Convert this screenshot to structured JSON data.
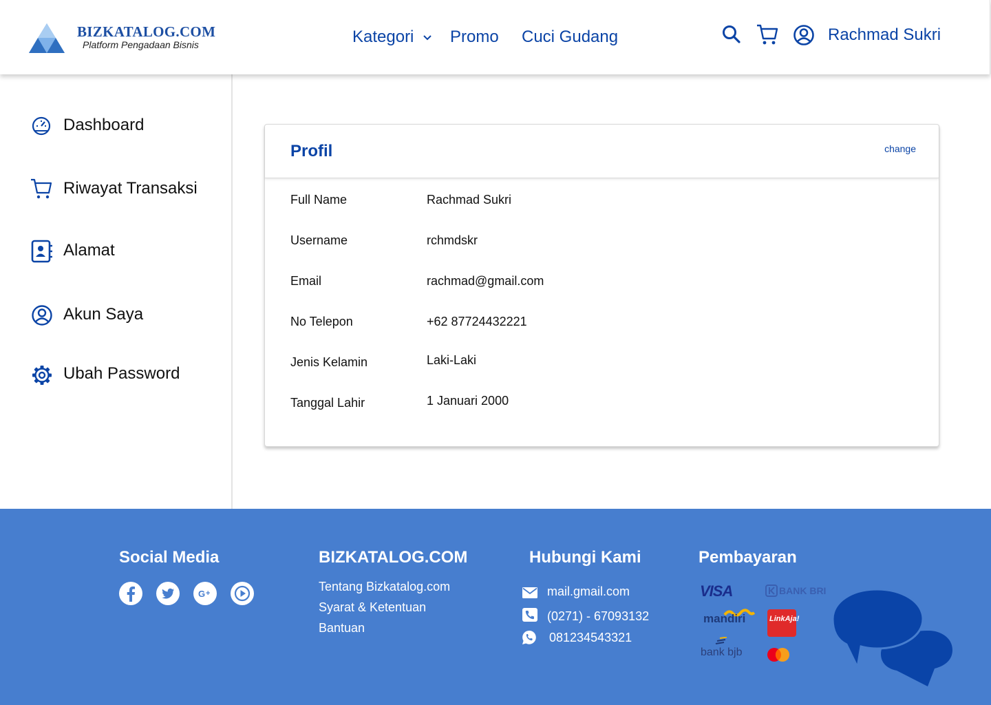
{
  "brand": {
    "name": "BIZKATALOG.COM",
    "tagline": "Platform Pengadaan Bisnis"
  },
  "header": {
    "nav": [
      {
        "label": "Kategori",
        "has_dropdown": true
      },
      {
        "label": "Promo"
      },
      {
        "label": "Cuci Gudang"
      }
    ],
    "icons": [
      "search-icon",
      "cart-icon",
      "user-circle-icon"
    ],
    "user_name": "Rachmad Sukri"
  },
  "sidebar": {
    "items": [
      {
        "label": "Dashboard",
        "icon": "speedometer-icon"
      },
      {
        "label": "Riwayat Transaksi",
        "icon": "cart-icon"
      },
      {
        "label": "Alamat",
        "icon": "address-book-icon"
      },
      {
        "label": "Akun Saya",
        "icon": "user-circle-icon"
      },
      {
        "label": "Ubah Password",
        "icon": "gear-icon"
      }
    ]
  },
  "profile": {
    "title": "Profil",
    "change_label": "change",
    "rows": [
      {
        "label": "Full Name",
        "value": "Rachmad Sukri"
      },
      {
        "label": "Username",
        "value": "rchmdskr"
      },
      {
        "label": "Email",
        "value": "rachmad@gmail.com"
      },
      {
        "label": "No Telepon",
        "value": "+62 87724432221"
      },
      {
        "label": "Jenis Kelamin",
        "value": "Laki-Laki"
      },
      {
        "label": "Tanggal Lahir",
        "value": "1 Januari 2000"
      }
    ]
  },
  "footer": {
    "social": {
      "heading": "Social Media",
      "icons": [
        "facebook-icon",
        "twitter-icon",
        "google-plus-icon",
        "play-icon"
      ]
    },
    "about": {
      "heading": "BIZKATALOG.COM",
      "links": [
        "Tentang Bizkatalog.com",
        "Syarat & Ketentuan",
        "Bantuan"
      ]
    },
    "contact": {
      "heading": "Hubungi Kami",
      "items": [
        {
          "icon": "mail-icon",
          "text": "mail.gmail.com"
        },
        {
          "icon": "phone-icon",
          "text": "(0271) - 67093132"
        },
        {
          "icon": "whatsapp-icon",
          "text": "081234543321"
        }
      ]
    },
    "payment": {
      "heading": "Pembayaran",
      "methods": [
        "VISA",
        "BANK BRI",
        "mandiri",
        "LinkAja!",
        "bank bjb",
        "mastercard"
      ]
    },
    "chat_icon": "chat-bubbles-icon"
  },
  "colors": {
    "primary": "#0b44a6",
    "footer_bg": "#477ecf",
    "chat_bubble": "#0a44a8"
  }
}
